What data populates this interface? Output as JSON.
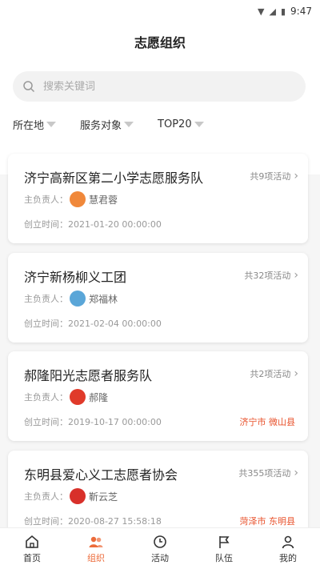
{
  "statusbar": {
    "time": "9:47"
  },
  "page": {
    "title": "志愿组织"
  },
  "search": {
    "placeholder": "搜索关键词"
  },
  "filters": [
    {
      "label": "所在地"
    },
    {
      "label": "服务对象"
    },
    {
      "label": "TOP20"
    }
  ],
  "labels": {
    "leader": "主负责人：",
    "created": "创立时间："
  },
  "cards": [
    {
      "title": "济宁高新区第二小学志愿服务队",
      "count": "共9项活动",
      "leader": "慧君蓉",
      "created": "2021-01-20 00:00:00",
      "location": "",
      "avatar_color": "#f0883a"
    },
    {
      "title": "济宁新杨柳义工团",
      "count": "共32项活动",
      "leader": "郑福林",
      "created": "2021-02-04 00:00:00",
      "location": "",
      "avatar_color": "#5aa6d8"
    },
    {
      "title": "郝隆阳光志愿者服务队",
      "count": "共2项活动",
      "leader": "郝隆",
      "created": "2019-10-17 00:00:00",
      "location": "济宁市  微山县",
      "avatar_color": "#e03a2a"
    },
    {
      "title": "东明县爱心义工志愿者协会",
      "count": "共355项活动",
      "leader": "靳云芝",
      "created": "2020-08-27 15:58:18",
      "location": "菏泽市  东明县",
      "avatar_color": "#d8302a"
    }
  ],
  "tabs": [
    {
      "label": "首页"
    },
    {
      "label": "组织"
    },
    {
      "label": "活动"
    },
    {
      "label": "队伍"
    },
    {
      "label": "我的"
    }
  ],
  "colors": {
    "accent": "#ec6b3a",
    "location": "#e8502a"
  }
}
